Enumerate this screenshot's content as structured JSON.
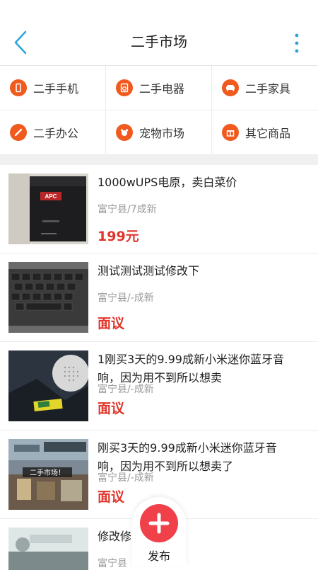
{
  "header": {
    "title": "二手市场"
  },
  "categories": [
    {
      "label": "二手手机",
      "icon": "phone-icon"
    },
    {
      "label": "二手电器",
      "icon": "washer-icon"
    },
    {
      "label": "二手家具",
      "icon": "sofa-icon"
    },
    {
      "label": "二手办公",
      "icon": "pencil-icon"
    },
    {
      "label": "宠物市场",
      "icon": "pet-icon"
    },
    {
      "label": "其它商品",
      "icon": "gift-icon"
    }
  ],
  "items": [
    {
      "title": "1000wUPS电原，卖白菜价",
      "meta": "富宁县/7成新",
      "price": "199元"
    },
    {
      "title": "测试测试测试修改下",
      "meta": "富宁县/-成新",
      "price": "面议"
    },
    {
      "title": "1刚买3天的9.99成新小米迷你蓝牙音响，因为用不到所以想卖",
      "meta": "富宁县/-成新",
      "price": "面议"
    },
    {
      "title": "刚买3天的9.99成新小米迷你蓝牙音响，因为用不到所以想卖了",
      "meta": "富宁县/-成新",
      "price": "面议"
    },
    {
      "title": "修改修",
      "meta": "富宁县"
    }
  ],
  "thumb_text": {
    "ups_brand": "APC",
    "market_sign": "二手市场！"
  },
  "fab": {
    "label": "发布"
  },
  "colors": {
    "accent": "#f05a1e",
    "price": "#e0352b",
    "back_icon": "#2aa4dc",
    "fab": "#f0404a"
  }
}
